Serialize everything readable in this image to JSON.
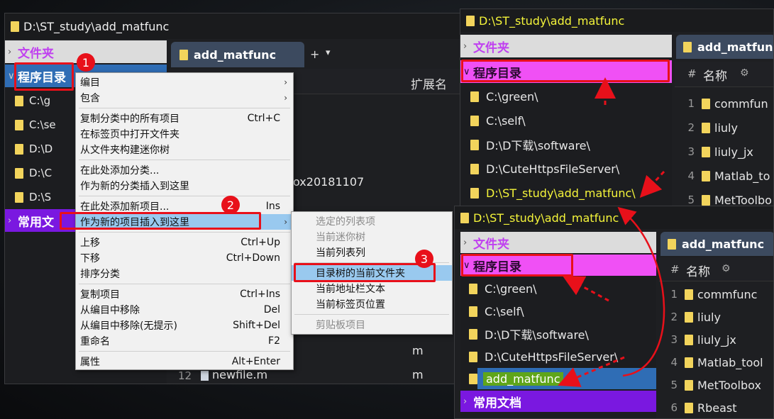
{
  "left": {
    "title": "D:\\ST_study\\add_matfunc",
    "cat1": "文件夹",
    "cat2": "程序目录",
    "cat3": "常用文",
    "tree": [
      "C:\\g",
      "C:\\se",
      "D:\\D",
      "D:\\C",
      "D:\\S"
    ],
    "tab": "add_matfunc",
    "tab_plus": "+",
    "tab_dropdown": "▾",
    "col_ext": "扩展名",
    "partial_text": "ox20181107",
    "ext_m1": "m",
    "ext_m2": "m",
    "row12_num": "12",
    "row12_name": "newfile.m"
  },
  "menu": {
    "items": [
      {
        "label": "编目",
        "shortcut": ""
      },
      {
        "label": "包含",
        "shortcut": ""
      },
      {
        "label": "复制分类中的所有项目",
        "shortcut": "Ctrl+C"
      },
      {
        "label": "在标签页中打开文件夹",
        "shortcut": ""
      },
      {
        "label": "从文件夹构建迷你树",
        "shortcut": ""
      },
      {
        "label": "在此处添加分类...",
        "shortcut": ""
      },
      {
        "label": "作为新的分类插入到这里",
        "shortcut": ""
      },
      {
        "label": "在此处添加新项目...",
        "shortcut": "Ins"
      },
      {
        "label": "作为新的项目插入到这里",
        "shortcut": ""
      },
      {
        "label": "上移",
        "shortcut": "Ctrl+Up"
      },
      {
        "label": "下移",
        "shortcut": "Ctrl+Down"
      },
      {
        "label": "排序分类",
        "shortcut": ""
      },
      {
        "label": "复制项目",
        "shortcut": "Ctrl+Ins"
      },
      {
        "label": "从编目中移除",
        "shortcut": "Del"
      },
      {
        "label": "从编目中移除(无提示)",
        "shortcut": "Shift+Del"
      },
      {
        "label": "重命名",
        "shortcut": "F2"
      },
      {
        "label": "属性",
        "shortcut": "Alt+Enter"
      }
    ],
    "submenu_arrow": "›"
  },
  "submenu": {
    "items": [
      {
        "label": "选定的列表项"
      },
      {
        "label": "当前迷你树"
      },
      {
        "label": "当前列表列"
      },
      {
        "label": "目录树的当前文件夹"
      },
      {
        "label": "当前地址栏文本"
      },
      {
        "label": "当前标签页位置"
      },
      {
        "label": "剪贴板项目"
      }
    ]
  },
  "badges": [
    "1",
    "2",
    "3"
  ],
  "right_top": {
    "title": "D:\\ST_study\\add_matfunc",
    "cat1": "文件夹",
    "cat2": "程序目录",
    "tree": [
      "C:\\green\\",
      "C:\\self\\",
      "D:\\D下载\\software\\",
      "D:\\CuteHttpsFileServer\\",
      "D:\\ST_study\\add_matfunc\\"
    ],
    "tab": "add_matfun",
    "col_hash": "#",
    "col_name": "名称",
    "rows": [
      {
        "num": "1",
        "name": "commfun"
      },
      {
        "num": "2",
        "name": "liuly"
      },
      {
        "num": "3",
        "name": "liuly_jx"
      },
      {
        "num": "4",
        "name": "Matlab_to"
      },
      {
        "num": "5",
        "name": "MetToolbo"
      }
    ]
  },
  "right_bottom": {
    "title": "D:\\ST_study\\add_matfunc",
    "cat1": "文件夹",
    "cat2": "程序目录",
    "cat3": "常用文档",
    "tree": [
      "C:\\green\\",
      "C:\\self\\",
      "D:\\D下载\\software\\",
      "D:\\CuteHttpsFileServer\\",
      "add_matfunc"
    ],
    "tab": "add_matfunc",
    "col_hash": "#",
    "col_name": "名称",
    "rows": [
      {
        "num": "1",
        "name": "commfunc"
      },
      {
        "num": "2",
        "name": "liuly"
      },
      {
        "num": "3",
        "name": "liuly_jx"
      },
      {
        "num": "4",
        "name": "Matlab_tool"
      },
      {
        "num": "5",
        "name": "MetToolbox"
      },
      {
        "num": "6",
        "name": "Rbeast"
      }
    ]
  },
  "colors": {
    "category_folder": "#d85cff",
    "category_program": "#f050f5",
    "category_common": "#7a18e0",
    "title_highlight": "#f5f53a",
    "annotation_red": "#e8101a",
    "menu_selected": "#99c9ef",
    "tab_bg": "#3c4a5f"
  }
}
